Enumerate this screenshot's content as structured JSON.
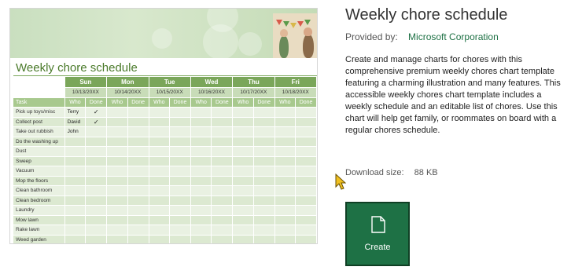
{
  "preview": {
    "sheet_title": "Weekly chore schedule",
    "task_header": "Task",
    "who_label": "Who",
    "done_label": "Done",
    "check_mark": "✓",
    "days": [
      {
        "day": "Sun",
        "date": "10/13/20XX"
      },
      {
        "day": "Mon",
        "date": "10/14/20XX"
      },
      {
        "day": "Tue",
        "date": "10/15/20XX"
      },
      {
        "day": "Wed",
        "date": "10/16/20XX"
      },
      {
        "day": "Thu",
        "date": "10/17/20XX"
      },
      {
        "day": "Fri",
        "date": "10/18/20XX"
      }
    ],
    "rows": [
      {
        "task": "Pick up toys/misc",
        "who": "Terry",
        "done": true
      },
      {
        "task": "Collect post",
        "who": "David",
        "done": true
      },
      {
        "task": "Take out rubbish",
        "who": "John",
        "done": false
      },
      {
        "task": "Do the washing up",
        "who": "",
        "done": false
      },
      {
        "task": "Dust",
        "who": "",
        "done": false
      },
      {
        "task": "Sweep",
        "who": "",
        "done": false
      },
      {
        "task": "Vacuum",
        "who": "",
        "done": false
      },
      {
        "task": "Mop the floors",
        "who": "",
        "done": false
      },
      {
        "task": "Clean bathroom",
        "who": "",
        "done": false
      },
      {
        "task": "Clean bedroom",
        "who": "",
        "done": false
      },
      {
        "task": "Laundry",
        "who": "",
        "done": false
      },
      {
        "task": "Mow lawn",
        "who": "",
        "done": false
      },
      {
        "task": "Rake lawn",
        "who": "",
        "done": false
      },
      {
        "task": "Weed garden",
        "who": "",
        "done": false
      }
    ]
  },
  "info": {
    "title": "Weekly chore schedule",
    "provided_label": "Provided by:",
    "provided_value": "Microsoft Corporation",
    "description": "Create and manage charts for chores with this comprehensive premium weekly chores chart template featuring a charming illustration and many features. This accessible weekly chores chart template includes a weekly schedule and an editable list of chores. Use this chart will help get family, or roommates on board with a regular chores schedule.",
    "download_label": "Download size:",
    "download_size": "88 KB",
    "create_label": "Create",
    "create_icon": "document-icon"
  },
  "colors": {
    "accent": "#1e7145",
    "sheet_green": "#7aa65a",
    "banner": "#c9dfbf"
  }
}
